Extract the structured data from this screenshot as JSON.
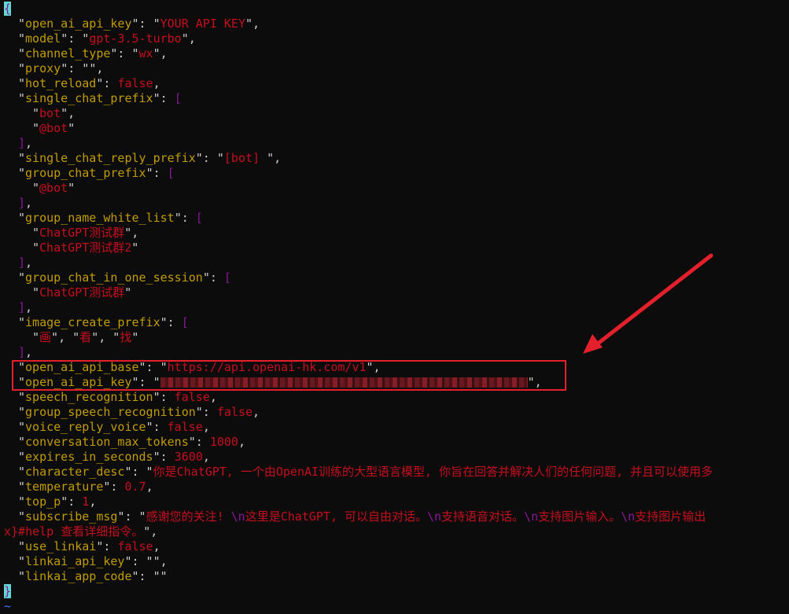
{
  "editor": {
    "open_brace": "{",
    "close_brace": "}",
    "eof_marker": "~",
    "config": {
      "open_ai_api_key_placeholder": {
        "key": "open_ai_api_key",
        "value": "YOUR API KEY"
      },
      "model": {
        "key": "model",
        "value": "gpt-3.5-turbo"
      },
      "channel_type": {
        "key": "channel_type",
        "value": "wx"
      },
      "proxy": {
        "key": "proxy",
        "value": ""
      },
      "hot_reload": {
        "key": "hot_reload",
        "value": "false"
      },
      "single_chat_prefix": {
        "key": "single_chat_prefix",
        "items": [
          "bot",
          "@bot"
        ]
      },
      "single_chat_reply_prefix": {
        "key": "single_chat_reply_prefix",
        "value": "[bot] "
      },
      "group_chat_prefix": {
        "key": "group_chat_prefix",
        "items": [
          "@bot"
        ]
      },
      "group_name_white_list": {
        "key": "group_name_white_list",
        "items": [
          "ChatGPT测试群",
          "ChatGPT测试群2"
        ]
      },
      "group_chat_in_one_session": {
        "key": "group_chat_in_one_session",
        "items": [
          "ChatGPT测试群"
        ]
      },
      "image_create_prefix": {
        "key": "image_create_prefix",
        "items": [
          "画",
          "看",
          "找"
        ]
      },
      "open_ai_api_base": {
        "key": "open_ai_api_base",
        "value": "https://api.openai-hk.com/v1"
      },
      "open_ai_api_key": {
        "key": "open_ai_api_key",
        "value": "[redacted]"
      },
      "speech_recognition": {
        "key": "speech_recognition",
        "value": "false"
      },
      "group_speech_recognition": {
        "key": "group_speech_recognition",
        "value": "false"
      },
      "voice_reply_voice": {
        "key": "voice_reply_voice",
        "value": "false"
      },
      "conversation_max_tokens": {
        "key": "conversation_max_tokens",
        "value": "1000"
      },
      "expires_in_seconds": {
        "key": "expires_in_seconds",
        "value": "3600"
      },
      "character_desc": {
        "key": "character_desc",
        "value": "你是ChatGPT, 一个由OpenAI训练的大型语言模型, 你旨在回答并解决人们的任何问题, 并且可以使用多"
      },
      "temperature": {
        "key": "temperature",
        "value": "0.7"
      },
      "top_p": {
        "key": "top_p",
        "value": "1"
      },
      "subscribe_msg": {
        "key": "subscribe_msg",
        "parts": [
          "感谢您的关注! ",
          "\\n",
          "这里是ChatGPT, 可以自由对话。",
          "\\n",
          "支持语音对话。",
          "\\n",
          "支持图片输入。",
          "\\n",
          "支持图片输出"
        ],
        "wrap": "x}#help 查看详细指令。"
      },
      "use_linkai": {
        "key": "use_linkai",
        "value": "false"
      },
      "linkai_api_key": {
        "key": "linkai_api_key",
        "value": ""
      },
      "linkai_app_code": {
        "key": "linkai_app_code",
        "value": ""
      }
    }
  },
  "annotation": {
    "color": "#e3202b",
    "target": "open_ai_api_base / open_ai_api_key"
  }
}
